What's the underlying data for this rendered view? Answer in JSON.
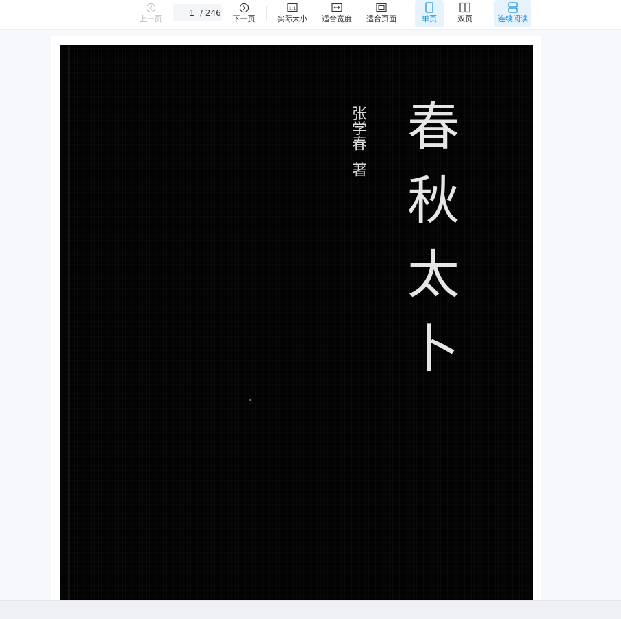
{
  "toolbar": {
    "prev_page": "上一页",
    "current_page": "1",
    "total_pages": "/ 246",
    "next_page": "下一页",
    "actual_size": "实际大小",
    "actual_size_icon_text": "1:1",
    "fit_width": "适合宽度",
    "fit_page": "适合页面",
    "single_page": "单页",
    "double_page": "双页",
    "continuous_read": "连续阅读"
  },
  "cover": {
    "title": "春秋太卜",
    "author": "张学春",
    "author_role": "著"
  },
  "colors": {
    "accent": "#1a8fd6",
    "active_bg": "#e7f3fc",
    "disabled": "#b9bcc2",
    "cover_bg": "#030303",
    "cover_text": "#e6e6e6"
  }
}
